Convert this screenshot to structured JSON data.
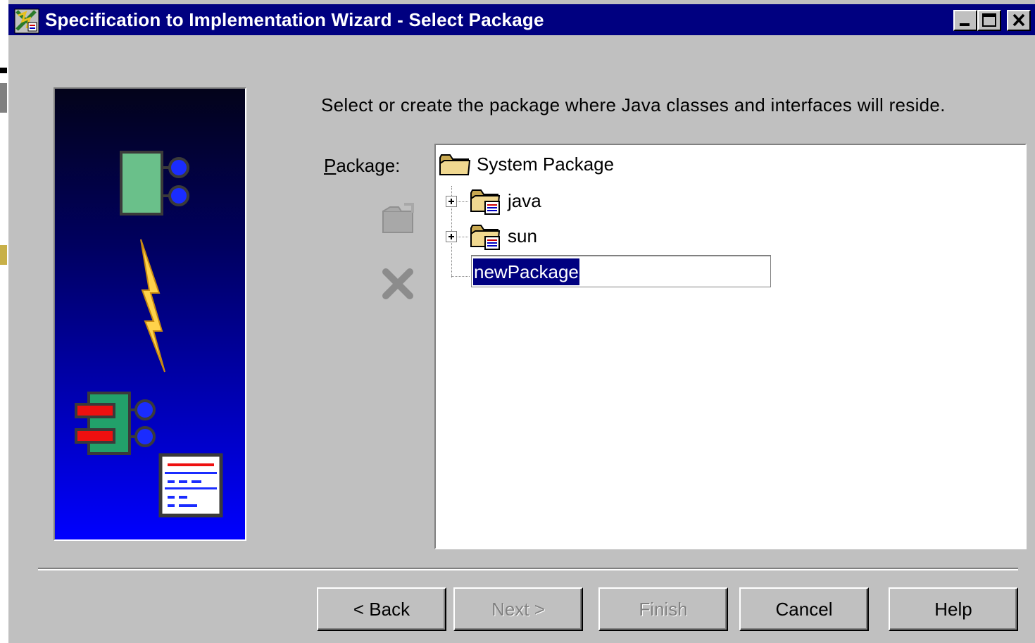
{
  "window": {
    "title": "Specification to Implementation Wizard - Select Package",
    "controls": [
      "minimize",
      "maximize",
      "close"
    ]
  },
  "instruction": "Select or create the package where Java classes and interfaces will reside.",
  "package_label": {
    "mnemonic": "P",
    "rest": "ackage:"
  },
  "side_buttons": [
    {
      "icon": "new-package-icon",
      "enabled": false
    },
    {
      "icon": "delete-icon",
      "enabled": false
    }
  ],
  "tree": {
    "root": {
      "label": "System Package",
      "icon": "folder-icon"
    },
    "children": [
      {
        "label": "java",
        "icon": "package-folder-icon",
        "expandable": true
      },
      {
        "label": "sun",
        "icon": "package-folder-icon",
        "expandable": true
      }
    ],
    "editing": {
      "value": "newPackage",
      "selected": true
    }
  },
  "buttons": {
    "back": "< Back",
    "next": "Next >",
    "finish": "Finish",
    "cancel": "Cancel",
    "help": "Help"
  },
  "colors": {
    "titlebar": "#000080",
    "face": "#c0c0c0",
    "selection": "#000080"
  }
}
